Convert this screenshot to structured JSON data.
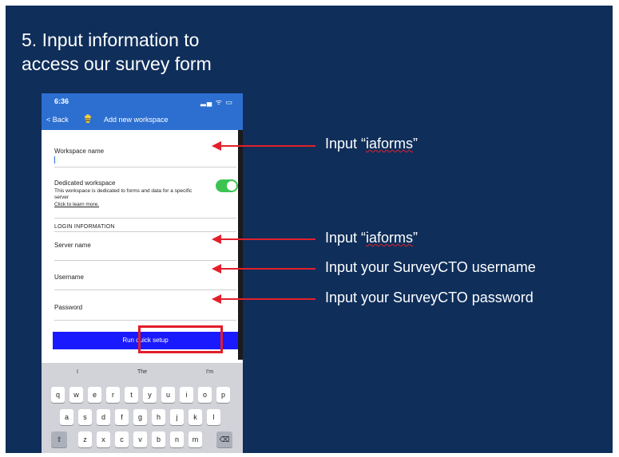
{
  "slide": {
    "title_line1": "5. Input information to",
    "title_line2": "access our survey form"
  },
  "phone": {
    "status_time": "6:36",
    "status_icons": "▂▄ ᯤ ▭",
    "nav_back": "< Back",
    "nav_title": "Add new workspace",
    "workspace_name_label": "Workspace name",
    "dedicated_label": "Dedicated workspace",
    "dedicated_desc": "This workspace is dedicated to forms and data for a specific server",
    "learn_more": "Click to learn more.",
    "dedicated_on": true,
    "login_section": "LOGIN INFORMATION",
    "server_label": "Server name",
    "username_label": "Username",
    "password_label": "Password",
    "run_button": "Run quick setup"
  },
  "keyboard": {
    "suggestions": [
      "I",
      "The",
      "I'm"
    ],
    "row1": [
      "q",
      "w",
      "e",
      "r",
      "t",
      "y",
      "u",
      "i",
      "o",
      "p"
    ],
    "row2": [
      "a",
      "s",
      "d",
      "f",
      "g",
      "h",
      "j",
      "k",
      "l"
    ],
    "row3": [
      "z",
      "x",
      "c",
      "v",
      "b",
      "n",
      "m"
    ],
    "shift_icon": "shift-icon",
    "delete_icon": "backspace-icon"
  },
  "annotations": {
    "workspace_word": "iaforms",
    "server_word": "iaforms",
    "username_note": "Input your SurveyCTO username",
    "password_note": "Input your SurveyCTO password",
    "input_prefix": "Input “",
    "input_suffix": "”"
  },
  "colors": {
    "slide_bg": "#0f2e5a",
    "header_blue": "#2d6fd0",
    "arrow_red": "#e2202b",
    "button_blue": "#1a1aff",
    "toggle_green": "#3cc453"
  }
}
